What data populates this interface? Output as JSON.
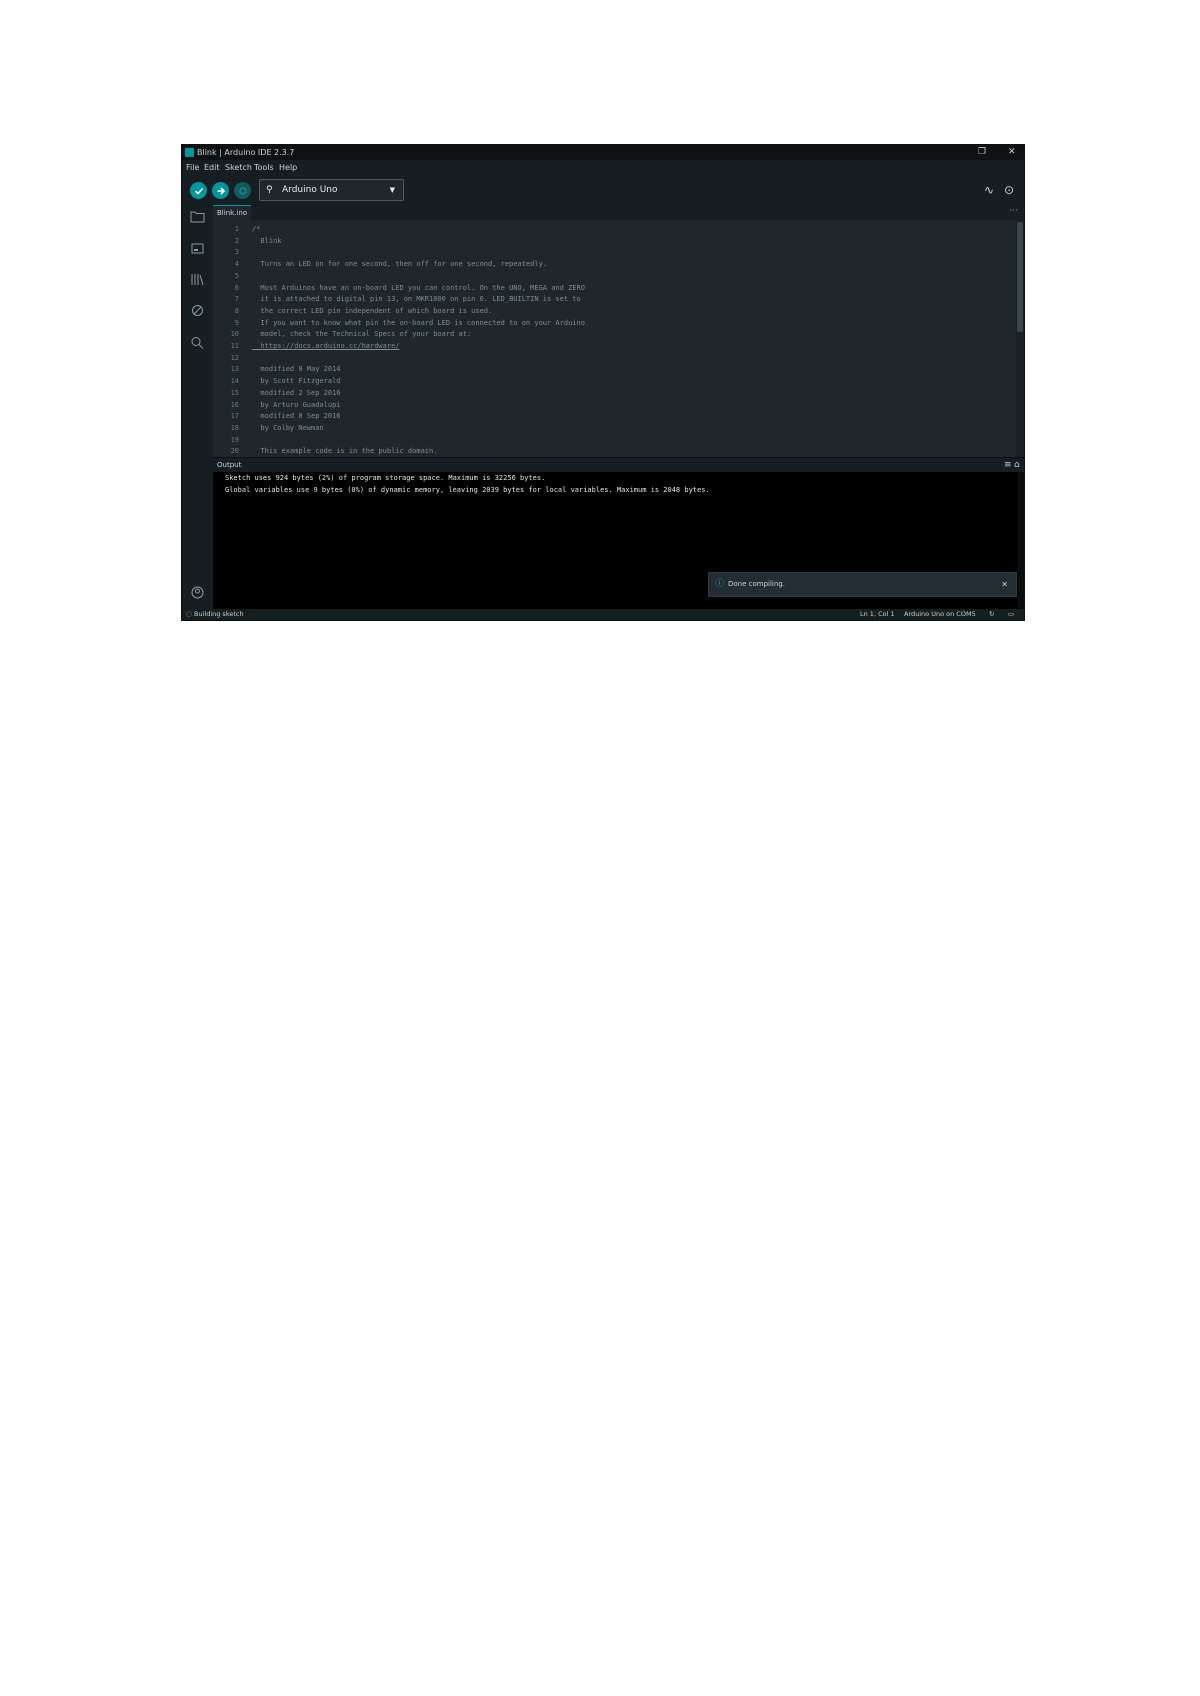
{
  "window": {
    "title": "Blink | Arduino IDE 2.3.7",
    "maximize_glyph": "❐",
    "close_glyph": "✕"
  },
  "menu": [
    "File",
    "Edit",
    "Sketch",
    "Tools",
    "Help"
  ],
  "toolbar": {
    "verify_icon": "check-icon",
    "upload_icon": "arrow-right-icon",
    "debug_icon": "debug-icon",
    "board_label": "Arduino Uno",
    "serial_plotter_icon": "plotter-icon",
    "serial_monitor_icon": "monitor-icon"
  },
  "colors": {
    "accent": "#00979d",
    "background": "#1f272a",
    "output_background": "#000000"
  },
  "sidebar": [
    "folder-icon",
    "boards-manager-icon",
    "library-icon",
    "debug-icon",
    "search-icon"
  ],
  "tabs": [
    {
      "label": "Blink.ino"
    }
  ],
  "editor": {
    "lines": [
      {
        "n": "1",
        "text": "/*"
      },
      {
        "n": "2",
        "text": "  Blink"
      },
      {
        "n": "3",
        "text": ""
      },
      {
        "n": "4",
        "text": "  Turns an LED on for one second, then off for one second, repeatedly."
      },
      {
        "n": "5",
        "text": ""
      },
      {
        "n": "6",
        "text": "  Most Arduinos have an on-board LED you can control. On the UNO, MEGA and ZERO"
      },
      {
        "n": "7",
        "text": "  it is attached to digital pin 13, on MKR1000 on pin 6. LED_BUILTIN is set to"
      },
      {
        "n": "8",
        "text": "  the correct LED pin independent of which board is used."
      },
      {
        "n": "9",
        "text": "  If you want to know what pin the on-board LED is connected to on your Arduino"
      },
      {
        "n": "10",
        "text": "  model, check the Technical Specs of your board at:"
      },
      {
        "n": "11",
        "text": "  https://docs.arduino.cc/hardware/"
      },
      {
        "n": "12",
        "text": ""
      },
      {
        "n": "13",
        "text": "  modified 8 May 2014"
      },
      {
        "n": "14",
        "text": "  by Scott Fitzgerald"
      },
      {
        "n": "15",
        "text": "  modified 2 Sep 2016"
      },
      {
        "n": "16",
        "text": "  by Arturo Guadalupi"
      },
      {
        "n": "17",
        "text": "  modified 8 Sep 2016"
      },
      {
        "n": "18",
        "text": "  by Colby Newman"
      },
      {
        "n": "19",
        "text": ""
      },
      {
        "n": "20",
        "text": "  This example code is in the public domain."
      }
    ]
  },
  "output": {
    "label": "Output",
    "lines": [
      "Sketch uses 924 bytes (2%) of program storage space. Maximum is 32256 bytes.",
      "Global variables use 9 bytes (0%) of dynamic memory, leaving 2039 bytes for local variables. Maximum is 2048 bytes."
    ]
  },
  "notification": {
    "message": "Done compiling.",
    "close_glyph": "✕"
  },
  "status": {
    "left": "Building sketch",
    "position": "Ln 1, Col 1",
    "board": "Arduino Uno on COM5"
  }
}
